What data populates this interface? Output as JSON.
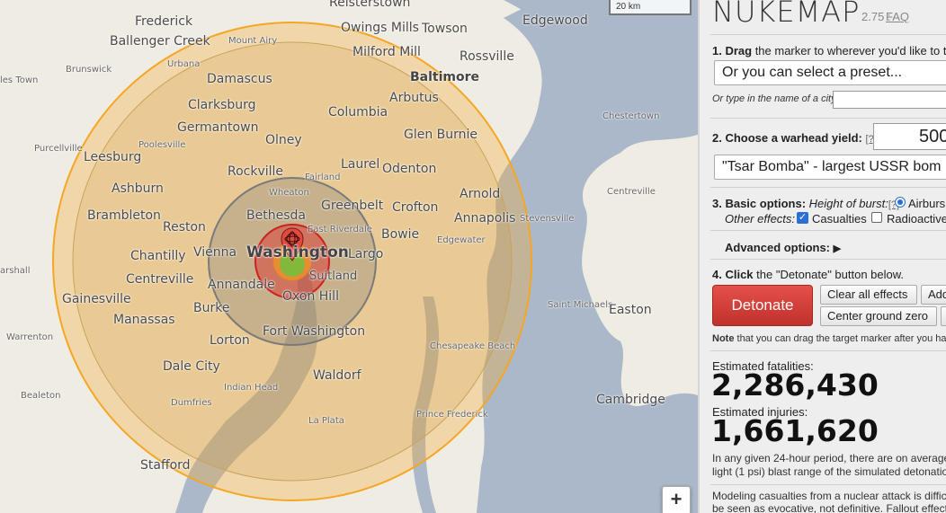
{
  "map": {
    "scale_label": "20 km",
    "zoom_in_label": "+",
    "places": [
      {
        "id": "frederick",
        "text": "Frederick",
        "cls": "p-l"
      },
      {
        "id": "ballenger-creek",
        "text": "Ballenger Creek",
        "cls": "p-l"
      },
      {
        "id": "mount-airy",
        "text": "Mount Airy",
        "cls": "p-s"
      },
      {
        "id": "reisterstown",
        "text": "Reisterstown",
        "cls": "p-l"
      },
      {
        "id": "owings-mills",
        "text": "Owings Mills",
        "cls": "p-l"
      },
      {
        "id": "towson",
        "text": "Towson",
        "cls": "p-l"
      },
      {
        "id": "edgewood",
        "text": "Edgewood",
        "cls": "p-l"
      },
      {
        "id": "milford-mill",
        "text": "Milford Mill",
        "cls": "p-l"
      },
      {
        "id": "rossville",
        "text": "Rossville",
        "cls": "p-l"
      },
      {
        "id": "brunswick",
        "text": "Brunswick",
        "cls": "p-s"
      },
      {
        "id": "urbana",
        "text": "Urbana",
        "cls": "p-s"
      },
      {
        "id": "damascus",
        "text": "Damascus",
        "cls": "p-l"
      },
      {
        "id": "baltimore",
        "text": "Baltimore",
        "cls": "p-b"
      },
      {
        "id": "les-town",
        "text": "les Town",
        "cls": "p-s"
      },
      {
        "id": "arbutus",
        "text": "Arbutus",
        "cls": "p-l"
      },
      {
        "id": "clarksburg",
        "text": "Clarksburg",
        "cls": "p-l"
      },
      {
        "id": "columbia",
        "text": "Columbia",
        "cls": "p-l"
      },
      {
        "id": "chestertown",
        "text": "Chestertown",
        "cls": "p-s"
      },
      {
        "id": "germantown",
        "text": "Germantown",
        "cls": "p-l"
      },
      {
        "id": "glen-burnie",
        "text": "Glen Burnie",
        "cls": "p-l"
      },
      {
        "id": "poolesville",
        "text": "Poolesville",
        "cls": "p-s"
      },
      {
        "id": "olney",
        "text": "Olney",
        "cls": "p-l"
      },
      {
        "id": "purcellville",
        "text": "Purcellville",
        "cls": "p-s"
      },
      {
        "id": "leesburg",
        "text": "Leesburg",
        "cls": "p-l"
      },
      {
        "id": "laurel",
        "text": "Laurel",
        "cls": "p-l"
      },
      {
        "id": "odenton",
        "text": "Odenton",
        "cls": "p-l"
      },
      {
        "id": "rockville",
        "text": "Rockville",
        "cls": "p-l"
      },
      {
        "id": "fairland",
        "text": "Fairland",
        "cls": "p-s"
      },
      {
        "id": "ashburn",
        "text": "Ashburn",
        "cls": "p-l"
      },
      {
        "id": "greenbelt",
        "text": "Greenbelt",
        "cls": "p-l"
      },
      {
        "id": "arnold",
        "text": "Arnold",
        "cls": "p-l"
      },
      {
        "id": "wheaton",
        "text": "Wheaton",
        "cls": "p-s"
      },
      {
        "id": "centreville-md",
        "text": "Centreville",
        "cls": "p-s"
      },
      {
        "id": "crofton",
        "text": "Crofton",
        "cls": "p-l"
      },
      {
        "id": "bethesda",
        "text": "Bethesda",
        "cls": "p-l"
      },
      {
        "id": "brambleton",
        "text": "Brambleton",
        "cls": "p-l"
      },
      {
        "id": "annapolis",
        "text": "Annapolis",
        "cls": "p-l"
      },
      {
        "id": "stevensville",
        "text": "Stevensville",
        "cls": "p-s"
      },
      {
        "id": "east-riverdale",
        "text": "East Riverdale",
        "cls": "p-s"
      },
      {
        "id": "reston",
        "text": "Reston",
        "cls": "p-l"
      },
      {
        "id": "bowie",
        "text": "Bowie",
        "cls": "p-l"
      },
      {
        "id": "edgewater",
        "text": "Edgewater",
        "cls": "p-s"
      },
      {
        "id": "marshall",
        "text": "arshall",
        "cls": "p-s"
      },
      {
        "id": "washington",
        "text": "Washington",
        "cls": "p-big"
      },
      {
        "id": "vienna",
        "text": "Vienna",
        "cls": "p-l"
      },
      {
        "id": "chantilly",
        "text": "Chantilly",
        "cls": "p-l"
      },
      {
        "id": "largo",
        "text": "Largo",
        "cls": "p-l"
      },
      {
        "id": "centreville-va",
        "text": "Centreville",
        "cls": "p-l"
      },
      {
        "id": "annandale",
        "text": "Annandale",
        "cls": "p-l"
      },
      {
        "id": "suitland",
        "text": "Suitland",
        "cls": "p-m"
      },
      {
        "id": "gainesville",
        "text": "Gainesville",
        "cls": "p-l"
      },
      {
        "id": "oxon-hill",
        "text": "Oxon Hill",
        "cls": "p-l"
      },
      {
        "id": "saint-michaels",
        "text": "Saint Michaels",
        "cls": "p-s"
      },
      {
        "id": "easton",
        "text": "Easton",
        "cls": "p-l"
      },
      {
        "id": "burke",
        "text": "Burke",
        "cls": "p-l"
      },
      {
        "id": "manassas",
        "text": "Manassas",
        "cls": "p-l"
      },
      {
        "id": "fort-washington",
        "text": "Fort Washington",
        "cls": "p-l"
      },
      {
        "id": "warrenton",
        "text": "Warrenton",
        "cls": "p-s"
      },
      {
        "id": "lorton",
        "text": "Lorton",
        "cls": "p-l"
      },
      {
        "id": "chesapeake-beach",
        "text": "Chesapeake Beach",
        "cls": "p-s"
      },
      {
        "id": "dale-city",
        "text": "Dale City",
        "cls": "p-l"
      },
      {
        "id": "waldorf",
        "text": "Waldorf",
        "cls": "p-l"
      },
      {
        "id": "indian-head",
        "text": "Indian Head",
        "cls": "p-s"
      },
      {
        "id": "bealeton",
        "text": "Bealeton",
        "cls": "p-s"
      },
      {
        "id": "cambridge",
        "text": "Cambridge",
        "cls": "p-l"
      },
      {
        "id": "dumfries",
        "text": "Dumfries",
        "cls": "p-s"
      },
      {
        "id": "prince-frederick",
        "text": "Prince Frederick",
        "cls": "p-s"
      },
      {
        "id": "la-plata",
        "text": "La Plata",
        "cls": "p-s"
      },
      {
        "id": "stafford",
        "text": "Stafford",
        "cls": "p-l"
      }
    ]
  },
  "panel": {
    "title": "NUKEMAP",
    "version": "2.75 :",
    "faq_label": "FAQ",
    "step1_bold": "1. Drag",
    "step1_rest": " the marker to wherever you'd like to t",
    "preset_select": "Or you can select a preset...",
    "city_label": "Or type in the name of a city:",
    "city_value": "",
    "step2_bold": "2. Choose a warhead yield:",
    "help_link": "[?]",
    "yield_value": "500",
    "yield_preset": "\"Tsar Bomba\" - largest USSR bom",
    "step3_bold": "3. Basic options:",
    "height_label": "Height of burst:",
    "airburst_label": "Airburs",
    "other_effects_label": "Other effects:",
    "casualties_label": "Casualties",
    "radioactive_label": "Radioactive",
    "advanced_label": "Advanced options:",
    "advanced_arrow": "▶",
    "step4_bold": "4. Click",
    "step4_rest": " the \"Detonate\" button below.",
    "detonate_label": "Detonate",
    "clear_label": "Clear all effects",
    "add_label": "Add",
    "center_label": "Center ground zero",
    "note_bold": "Note",
    "note_rest": " that you can drag the target marker after you hav",
    "fatalities_label": "Estimated fatalities:",
    "fatalities_value": "2,286,430",
    "injuries_label": "Estimated injuries:",
    "injuries_value": "1,661,620",
    "para1_line1": "In any given 24-hour period, there are on average c",
    "para1_line2": "light (1 psi) blast range of the simulated detonation",
    "para2_line1": "Modeling casualties from a nuclear attack is difficu",
    "para2_line2": "be seen as evocative, not definitive. Fallout effects"
  },
  "colors": {
    "accent_red": "#d33a35",
    "fireball": "#f0d040",
    "land": "#efece4",
    "water": "#a9b9cb",
    "outer_ring": "#f5a623"
  }
}
